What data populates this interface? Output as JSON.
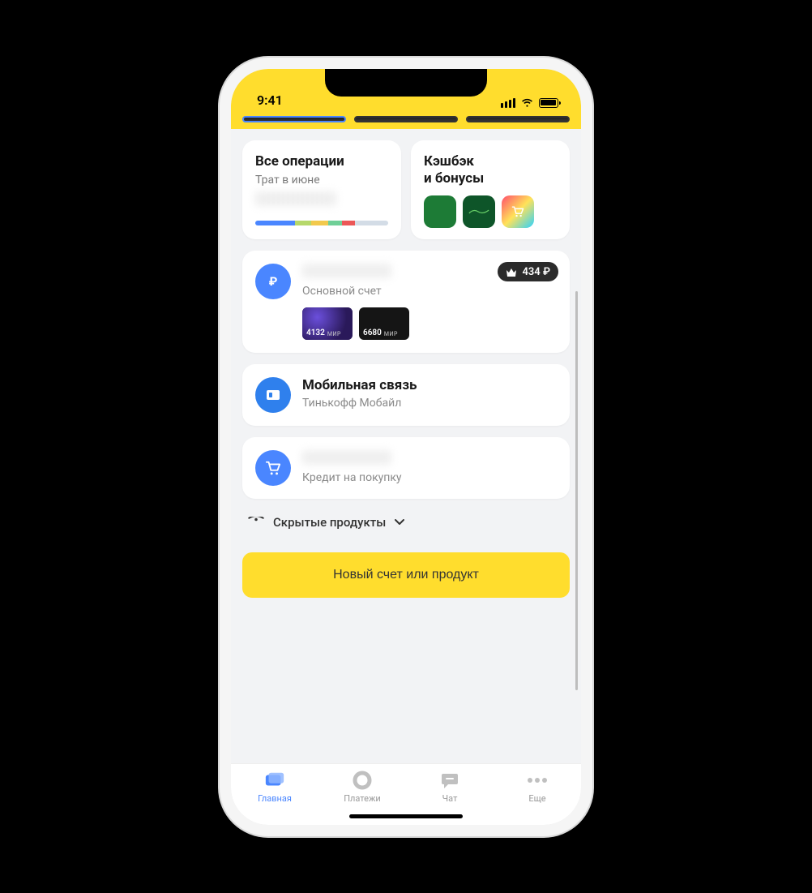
{
  "statusbar": {
    "time": "9:41"
  },
  "operations": {
    "title": "Все операции",
    "subtitle": "Трат в июне"
  },
  "cashback": {
    "title_line1": "Кэшбэк",
    "title_line2": "и бонусы"
  },
  "accounts": {
    "main": {
      "label": "Основной счет",
      "cards": [
        {
          "last4": "4132",
          "system": "МИР"
        },
        {
          "last4": "6680",
          "system": "МИР"
        }
      ],
      "badge_value": "434 ₽"
    },
    "mobile": {
      "title": "Мобильная связь",
      "subtitle": "Тинькофф Мобайл"
    },
    "loan": {
      "label": "Кредит на покупку"
    }
  },
  "hidden_products_label": "Скрытые продукты",
  "new_product_button": "Новый счет или продукт",
  "tabs": {
    "home": "Главная",
    "payments": "Платежи",
    "chat": "Чат",
    "more": "Еще"
  }
}
